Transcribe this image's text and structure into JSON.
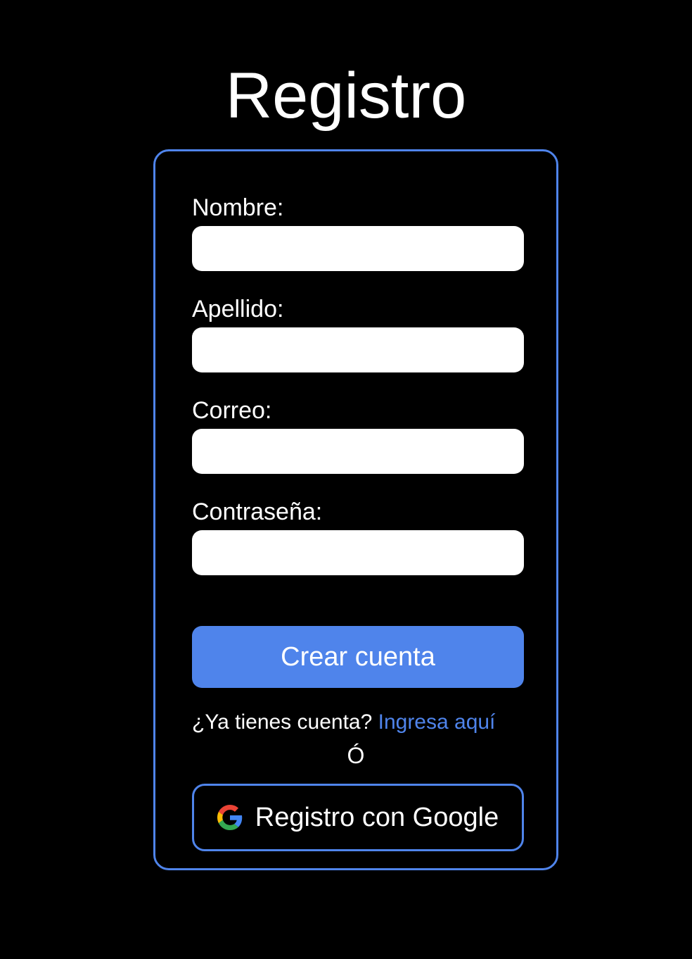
{
  "page": {
    "title": "Registro"
  },
  "form": {
    "fields": [
      {
        "label": "Nombre:",
        "value": "",
        "placeholder": ""
      },
      {
        "label": "Apellido:",
        "value": "",
        "placeholder": ""
      },
      {
        "label": "Correo:",
        "value": "",
        "placeholder": ""
      },
      {
        "label": "Contraseña:",
        "value": "",
        "placeholder": ""
      }
    ],
    "submit_label": "Crear cuenta",
    "login_prompt": "¿Ya tienes cuenta? ",
    "login_link": "Ingresa aquí",
    "separator": "Ó",
    "google_label": "Registro con Google",
    "google_icon": "google-g-icon"
  },
  "colors": {
    "background": "#000000",
    "accent": "#4f84eb",
    "text": "#ffffff",
    "input_bg": "#ffffff"
  }
}
